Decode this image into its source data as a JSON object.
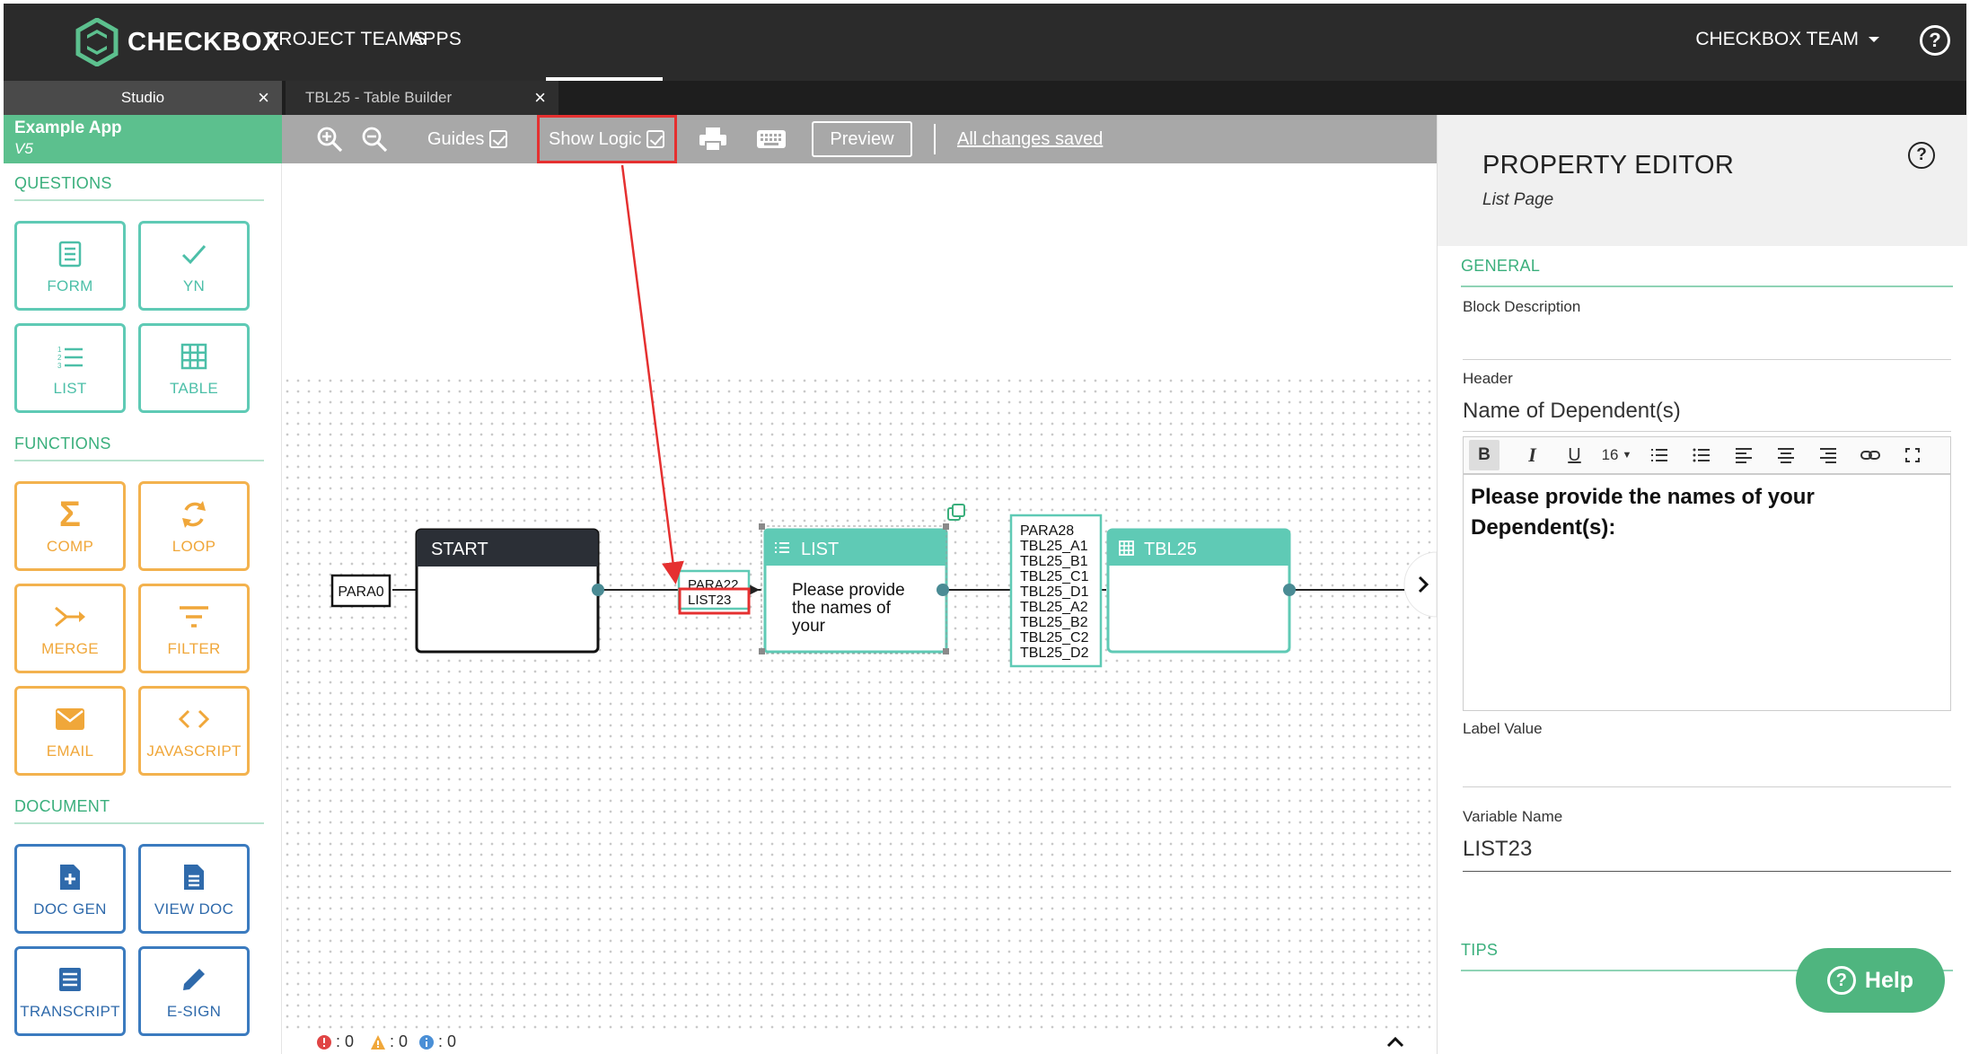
{
  "brand": {
    "name": "CHECKBOX"
  },
  "nav": {
    "items": [
      {
        "label": "PROJECT TEAMS"
      },
      {
        "label": "APPS"
      }
    ],
    "team": "CHECKBOX TEAM",
    "help": "?"
  },
  "tabs": [
    {
      "label": "Studio",
      "close": "×"
    },
    {
      "label": "TBL25 - Table Builder",
      "close": "×"
    }
  ],
  "sidebar": {
    "app_name": "Example App",
    "app_version": "V5",
    "sections": {
      "questions": "QUESTIONS",
      "functions": "FUNCTIONS",
      "document": "DOCUMENT"
    },
    "tiles": {
      "form": "FORM",
      "yn": "YN",
      "list": "LIST",
      "table": "TABLE",
      "comp": "COMP",
      "loop": "LOOP",
      "merge": "MERGE",
      "filter": "FILTER",
      "email": "EMAIL",
      "javascript": "JAVASCRIPT",
      "doc_gen": "DOC GEN",
      "view_doc": "VIEW DOC",
      "transcript": "TRANSCRIPT",
      "e_sign": "E-SIGN"
    }
  },
  "toolbar": {
    "guides": "Guides",
    "show_logic": "Show Logic",
    "preview": "Preview",
    "saved": "All changes saved"
  },
  "diagram": {
    "para0": "PARA0",
    "start": "START",
    "list_pre": [
      "PARA22",
      "LIST23"
    ],
    "list_title": "LIST",
    "list_body": [
      "Please provide",
      "the names of",
      "your"
    ],
    "tbl_pre": [
      "PARA28",
      "TBL25_A1",
      "TBL25_B1",
      "TBL25_C1",
      "TBL25_D1",
      "TBL25_A2",
      "TBL25_B2",
      "TBL25_C2",
      "TBL25_D2"
    ],
    "tbl_title": "TBL25"
  },
  "status": {
    "errors": ": 0",
    "warnings": ": 0",
    "info": ": 0"
  },
  "property_editor": {
    "title": "PROPERTY EDITOR",
    "subtitle": "List Page",
    "general": "GENERAL",
    "block_description_label": "Block Description",
    "header_label": "Header",
    "header_value": "Name of Dependent(s)",
    "font_size": "16",
    "rich_text": "Please provide the names of your Dependent(s):",
    "label_value_label": "Label Value",
    "variable_name_label": "Variable Name",
    "variable_name_value": "LIST23",
    "tips": "TIPS",
    "help_button": "Help"
  },
  "colors": {
    "accent": "#5cc08e",
    "teal": "#5fcab5",
    "orange": "#f3b24e",
    "blue": "#3b7bbf",
    "highlight": "#e53030"
  }
}
